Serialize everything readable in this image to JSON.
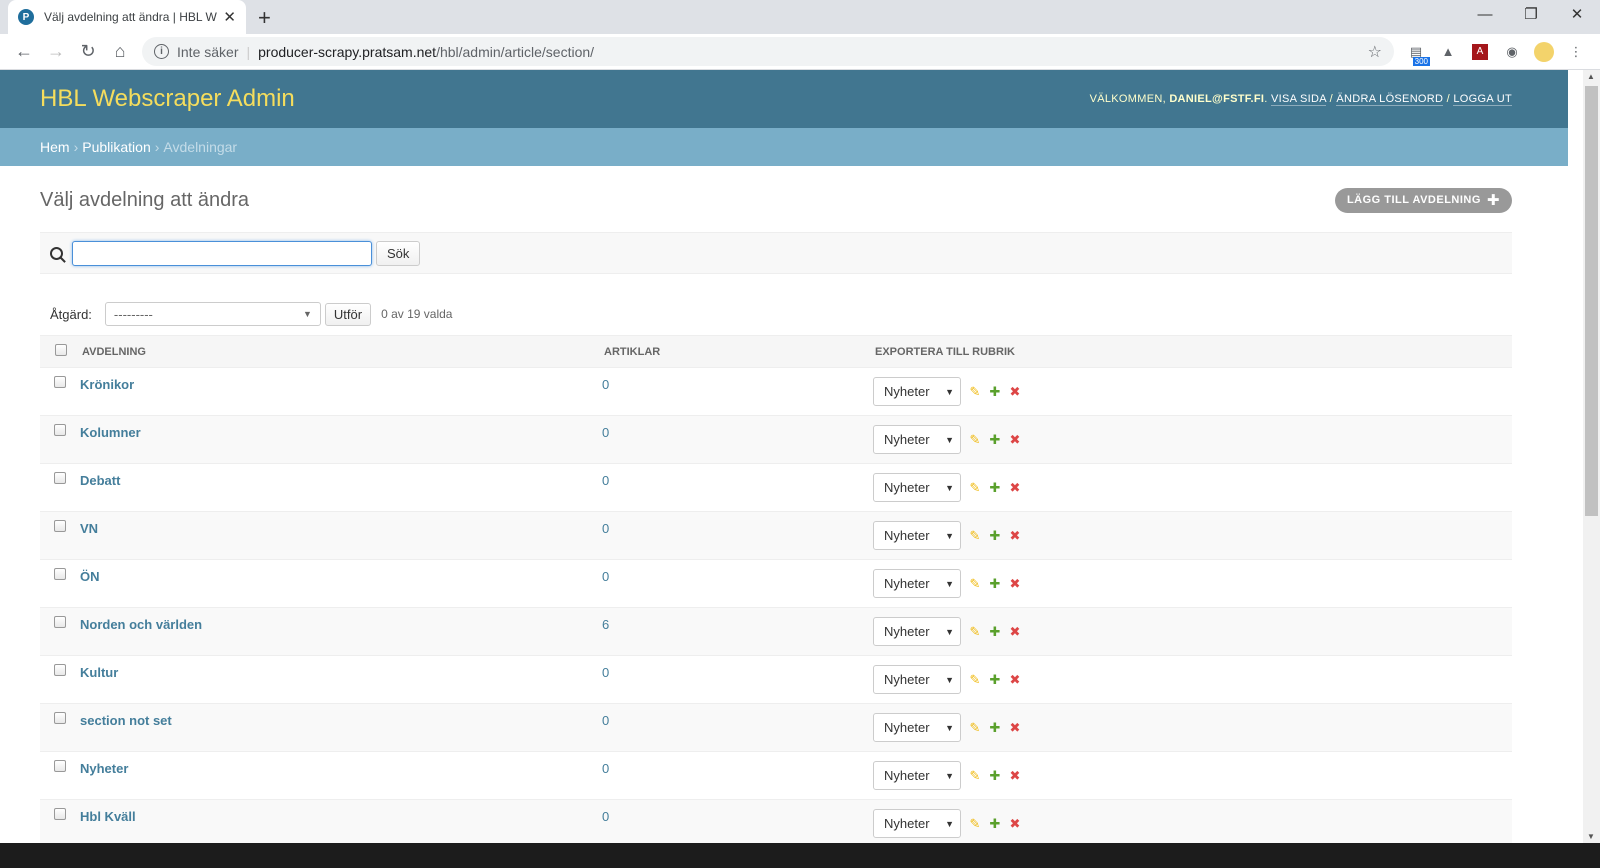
{
  "browser": {
    "tab_title": "Välj avdelning att ändra | HBL We",
    "new_tab": "+",
    "security": "Inte säker",
    "url_host": "producer-scrapy.pratsam.net",
    "url_path": "/hbl/admin/article/section/",
    "ext_badge": "300"
  },
  "header": {
    "branding": "HBL Webscraper Admin",
    "welcome": "Välkommen,",
    "user": "daniel@fstf.fi",
    "view_site": "Visa sida",
    "change_password": "Ändra lösenord",
    "logout": "Logga ut"
  },
  "breadcrumbs": {
    "home": "Hem",
    "app": "Publikation",
    "current": "Avdelningar"
  },
  "page": {
    "title": "Välj avdelning att ändra",
    "add_button": "Lägg till avdelning"
  },
  "search": {
    "value": "",
    "button": "Sök"
  },
  "actions": {
    "label": "Åtgärd:",
    "selected": "---------",
    "go": "Utför",
    "counter": "0 av 19 valda"
  },
  "table": {
    "headers": [
      "Avdelning",
      "Artiklar",
      "Exportera till rubrik"
    ],
    "rows": [
      {
        "name": "Krönikor",
        "count": "0",
        "rubrik": "Nyheter"
      },
      {
        "name": "Kolumner",
        "count": "0",
        "rubrik": "Nyheter"
      },
      {
        "name": "Debatt",
        "count": "0",
        "rubrik": "Nyheter"
      },
      {
        "name": "VN",
        "count": "0",
        "rubrik": "Nyheter"
      },
      {
        "name": "ÖN",
        "count": "0",
        "rubrik": "Nyheter"
      },
      {
        "name": "Norden och världen",
        "count": "6",
        "rubrik": "Nyheter"
      },
      {
        "name": "Kultur",
        "count": "0",
        "rubrik": "Nyheter"
      },
      {
        "name": "section not set",
        "count": "0",
        "rubrik": "Nyheter"
      },
      {
        "name": "Nyheter",
        "count": "0",
        "rubrik": "Nyheter"
      },
      {
        "name": "Hbl Kväll",
        "count": "0",
        "rubrik": "Nyheter"
      }
    ]
  }
}
